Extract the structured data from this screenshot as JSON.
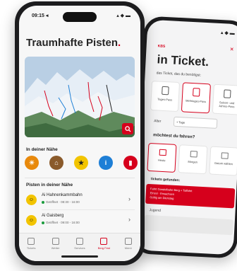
{
  "front": {
    "status": {
      "time": "09:15 ◂",
      "icons": "▴ ◆ ▬"
    },
    "title": "Traumhafte Pisten",
    "title_suffix": ".",
    "nearby": {
      "heading": "In deiner Nähe",
      "buttons": [
        {
          "name": "food",
          "glyph": "☀",
          "color": "#e8890c"
        },
        {
          "name": "hut",
          "glyph": "⌂",
          "color": "#8a5a2b"
        },
        {
          "name": "star",
          "glyph": "★",
          "color": "#f2c400"
        },
        {
          "name": "info",
          "glyph": "i",
          "color": "#1e7fd6"
        },
        {
          "name": "bookmark",
          "glyph": "▮",
          "color": "#d6001c"
        }
      ]
    },
    "pistes": {
      "heading": "Pisten in deiner Nähe",
      "items": [
        {
          "name": "Ai Hahnenkammbahn",
          "status": "Geöffnet · 08:30 - 16:00"
        },
        {
          "name": "Ai Gaisberg",
          "status": "Geöffnet · 09:00 - 16:00"
        }
      ]
    },
    "nav": [
      {
        "label": "Tickets",
        "active": false
      },
      {
        "label": "Wetter",
        "active": false
      },
      {
        "label": "Services",
        "active": false
      },
      {
        "label": "Berg Fest",
        "active": true
      },
      {
        "label": "Menü",
        "active": false
      }
    ]
  },
  "back": {
    "status": "▴ ◆ ▬",
    "logo": "KBS",
    "close": "✕",
    "title": "in Ticket.",
    "subtitle": "das Ticket, das du benötigst:",
    "options": [
      {
        "label": "Tages-Pass",
        "selected": false
      },
      {
        "label": "Mehrtages-Pass",
        "selected": true
      },
      {
        "label": "Saison- und Jahres-Pass",
        "selected": false
      }
    ],
    "age_label": "Alter",
    "age_value": "+ Tage",
    "when": "möchtest du fahren?",
    "days": [
      {
        "label": "Heute",
        "selected": true
      },
      {
        "label": "Morgen",
        "selected": false
      },
      {
        "label": "Datum wählen",
        "selected": false
      }
    ],
    "found": "tickets gefunden:",
    "result_line1": "Fahrt Gondelbahn Berg + Talfahrt",
    "result_line2": "Einzel · Erwachsen",
    "result_line3": "Gültig am Dienstag",
    "youth": "Jugend"
  }
}
